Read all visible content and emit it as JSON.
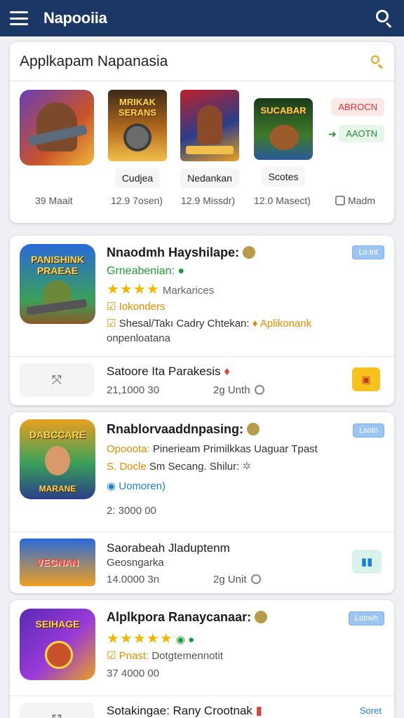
{
  "appbar": {
    "title": "Napooiia"
  },
  "featured": {
    "title": "Applkapam Napanasia",
    "items": [
      {
        "label": "",
        "meta": "39 Maait",
        "thumb_text": ""
      },
      {
        "label": "Cudjea",
        "meta": "12.9 7osen)",
        "thumb_text": "MRIKAK SERANS"
      },
      {
        "label": "Nedankan",
        "meta": "12.9 Missdr)",
        "thumb_text": ""
      },
      {
        "label": "Scotes",
        "meta": "12.0 Masect)",
        "thumb_text": "SUCABAR"
      }
    ],
    "chip_red": "ABROCN",
    "chip_green": "AAOTN",
    "extra_meta": "Madm"
  },
  "apps": [
    {
      "thumb_text": "PANISHINK PRAEAE",
      "name": "Nnaodmh Hayshilape:",
      "sub": "Grneabenian:",
      "rating_label": "Markarices",
      "tag": "Iokonders",
      "line1_a": "Shesal/Takı Cadry Chtekan:",
      "line1_b": "Aplikonank",
      "line2": "onpenloatana",
      "badge": "Lo.tnt",
      "footer_name": "Satoore Ita Parakesis",
      "footer_count": "21,1000 30",
      "footer_unit": "2g Unth"
    },
    {
      "thumb_text": "DABCCARE",
      "thumb_text2": "MARANE",
      "name": "Rnablorvaaddnpasing:",
      "line1_a": "Opooota:",
      "line1_b": "Pinerieam Primilkkas Uaguar Tpast",
      "line2_a": "S. Docle",
      "line2_b": "Sm Secang. Shilur:",
      "tag": "Uomoren)",
      "count": "2: 3000 00",
      "badge": "Lsotn",
      "footer_thumb": "VEGNAN",
      "footer_name": "Saorabeah Jladuptenm",
      "footer_sub": "Geosngarka",
      "footer_count": "14.0000 3n",
      "footer_unit": "2g Unit"
    },
    {
      "thumb_text": "SEIHAGE",
      "name": "Alplkpora Ranaycanaar:",
      "tag_a": "Pnast:",
      "tag_b": "Dotgtemennotit",
      "count": "37 4000 00",
      "badge": "Lotnvh",
      "footer_name": "Sotakingae: Rany Crootnak",
      "footer_badge": "Soret"
    }
  ]
}
